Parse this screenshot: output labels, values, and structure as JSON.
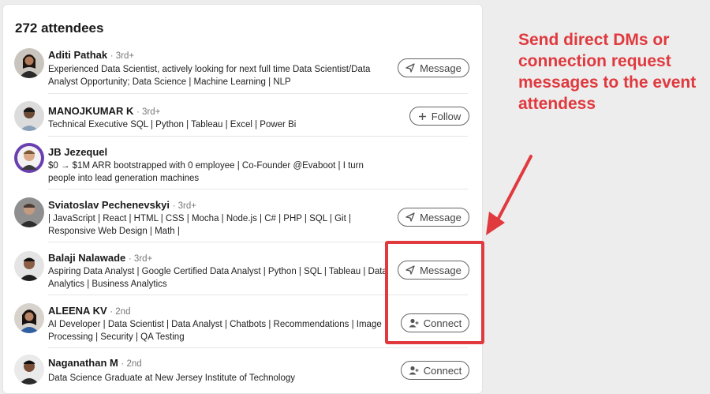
{
  "header": {
    "count": "272 attendees"
  },
  "attendees": [
    {
      "name": "Aditi Pathak",
      "degree": "· 3rd+",
      "headline": "Experienced Data Scientist, actively looking for next full time Data Scientist/Data Analyst Opportunity; Data Science | Machine Learning | NLP",
      "action": "Message",
      "action_icon": "send-icon"
    },
    {
      "name": "MANOJKUMAR K",
      "degree": "· 3rd+",
      "headline": "Technical Executive SQL | Python | Tableau | Excel | Power Bi",
      "action": "Follow",
      "action_icon": "plus-icon"
    },
    {
      "name": "JB Jezequel",
      "degree": "",
      "headline": "$0 → $1M ARR bootstrapped with 0 employee | Co-Founder @Evaboot | I turn people into lead generation machines",
      "action": "",
      "action_icon": ""
    },
    {
      "name": "Sviatoslav Pechenevskyi",
      "degree": "· 3rd+",
      "headline": "| JavaScript | React | HTML | CSS | Mocha | Node.js | C# | PHP | SQL | Git | Responsive Web Design | Math |",
      "action": "Message",
      "action_icon": "send-icon"
    },
    {
      "name": "Balaji Nalawade",
      "degree": "· 3rd+",
      "headline": "Aspiring Data Analyst | Google Certified Data Analyst | Python | SQL | Tableau | Data Analytics | Business Analytics",
      "action": "Message",
      "action_icon": "send-icon"
    },
    {
      "name": "ALEENA KV",
      "degree": "· 2nd",
      "headline": "AI Developer | Data Scientist | Data Analyst | Chatbots | Recommendations | Image Processing | Security | QA Testing",
      "action": "Connect",
      "action_icon": "person-add-icon"
    },
    {
      "name": "Naganathan M",
      "degree": "· 2nd",
      "headline": "Data Science Graduate at New Jersey Institute of Technology",
      "action": "Connect",
      "action_icon": "person-add-icon"
    }
  ],
  "annotation": {
    "text": "Send direct DMs or connection request messages to the event attendess",
    "color": "#e0393e"
  },
  "colors": {
    "accent_red": "#e0393e",
    "button_border": "#646464"
  }
}
